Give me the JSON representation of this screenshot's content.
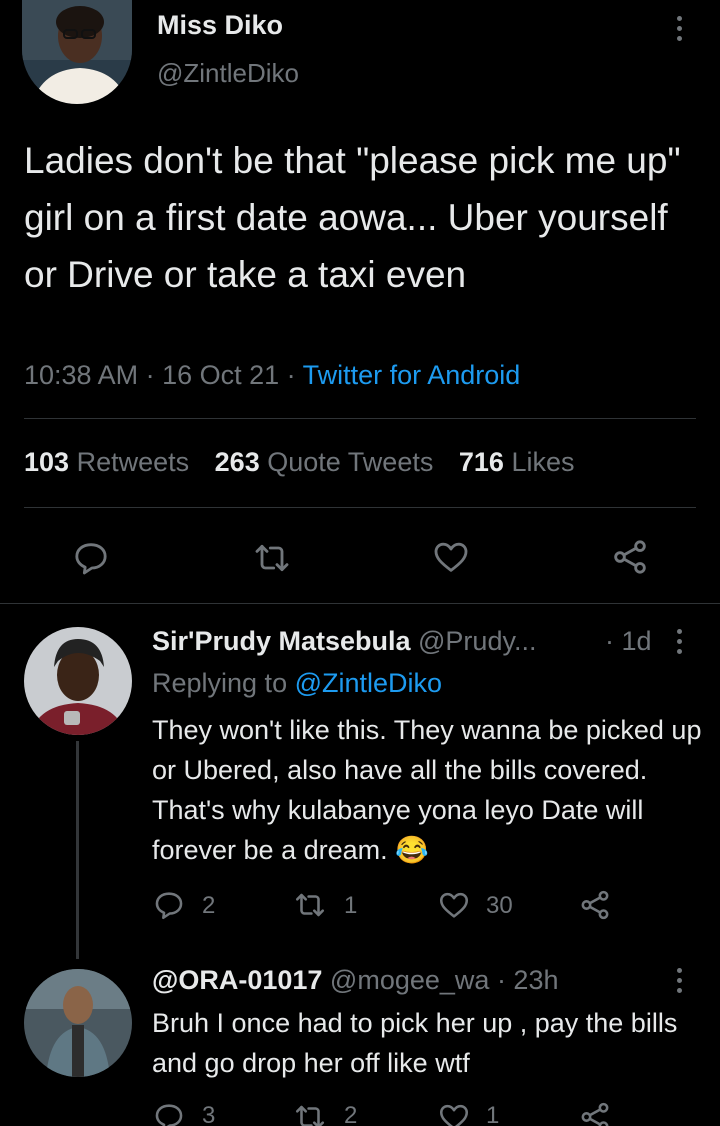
{
  "tweet": {
    "author_name": "Miss Diko",
    "author_handle": "@ZintleDiko",
    "text": "Ladies don't be that \"please pick me up\" girl on a first date aowa... Uber yourself or Drive or take a taxi even",
    "time": "10:38 AM · 16 Oct 21 · ",
    "source": "Twitter for Android",
    "stats": {
      "retweets_count": "103",
      "retweets_label": "Retweets",
      "quotes_count": "263",
      "quotes_label": "Quote Tweets",
      "likes_count": "716",
      "likes_label": "Likes"
    }
  },
  "replies": [
    {
      "name": "Sir'Prudy Matsebula",
      "handle": "@Prudy...",
      "age": "· 1d",
      "replying_prefix": "Replying to ",
      "replying_to": "@ZintleDiko",
      "text": "They won't like this. They wanna be picked up or Ubered, also have all the bills covered. That's why kulabanye yona leyo Date will forever be a dream. 😂",
      "reply_count": "2",
      "retweet_count": "1",
      "like_count": "30"
    },
    {
      "name": "@ORA-01017",
      "handle": "@mogee_wa",
      "age": "· 23h",
      "text": "Bruh I once had to pick her up , pay the bills and go drop her off like wtf",
      "reply_count": "3",
      "retweet_count": "2",
      "like_count": "1"
    }
  ],
  "colors": {
    "background": "#000000",
    "text": "#e7e9ea",
    "muted": "#71767b",
    "link": "#1d9bf0",
    "divider": "#2f3336"
  },
  "icons": [
    "more-icon",
    "reply-icon",
    "retweet-icon",
    "like-icon",
    "share-icon"
  ]
}
